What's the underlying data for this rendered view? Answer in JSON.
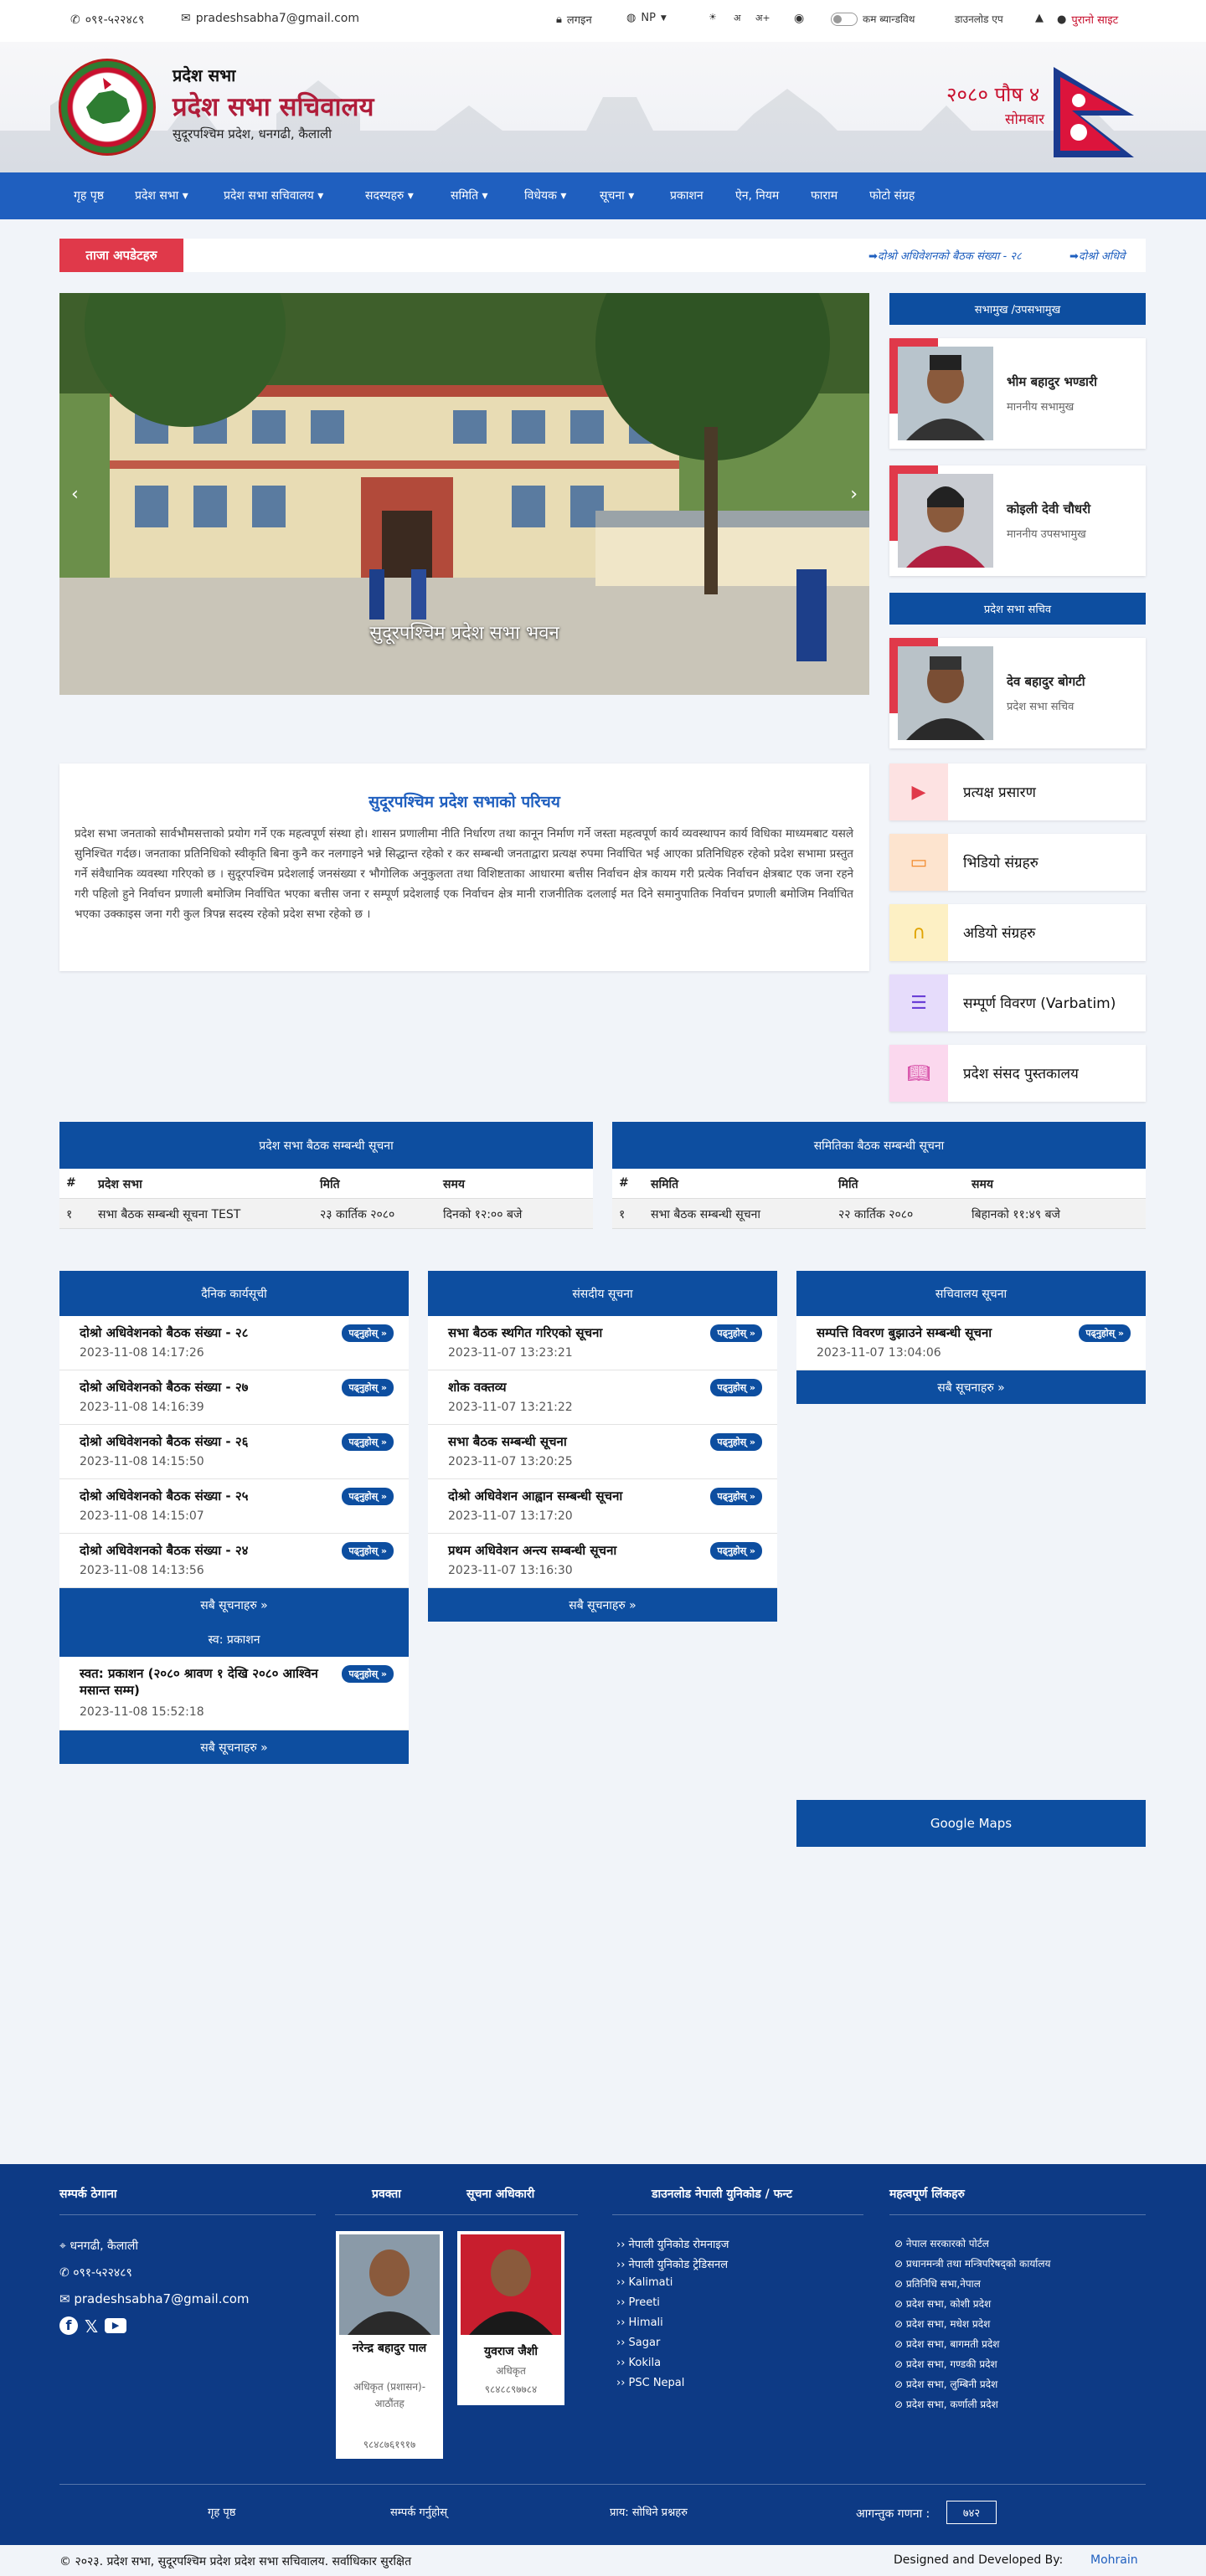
{
  "topbar": {
    "phone": "०९१-५२२४८९",
    "email": "pradeshsabha7@gmail.com",
    "login": "लगइन",
    "lang": "NP",
    "font_minus": "अ-",
    "font_normal": "अ",
    "font_plus": "अ+",
    "contrast": "कम ब्यान्डविथ",
    "download_app": "डाउनलोड एप",
    "old_site": "पुरानो साइट"
  },
  "header": {
    "brand_small": "प्रदेश सभा",
    "brand_title": "प्रदेश सभा सचिवालय",
    "brand_sub": "सुदूरपश्चिम प्रदेश, धनगढी, कैलाली",
    "date": "२०८० पौष ४",
    "day": "सोमबार"
  },
  "nav": [
    "गृह पृष्ठ",
    "प्रदेश सभा ▾",
    "प्रदेश सभा सचिवालय ▾",
    "सदस्यहरु ▾",
    "समिति ▾",
    "विधेयक ▾",
    "सूचना ▾",
    "प्रकाशन",
    "ऐन, नियम",
    "फाराम",
    "फोटो संग्रह"
  ],
  "ticker": {
    "label": "ताजा अपडेटहरु",
    "item1": "➡दोश्रो अधिवेशनको बैठक संख्या - २८",
    "item2": "➡दोश्रो अधिवे"
  },
  "slider": {
    "caption": "सुदूरपश्चिम प्रदेश सभा भवन"
  },
  "sidebar": {
    "head1": "सभामुख /उपसभामुख",
    "speaker_name": "भीम बहादुर भण्डारी",
    "speaker_role": "माननीय सभामुख",
    "deputy_name": "कोइली देवी चौधरी",
    "deputy_role": "माननीय उपसभामुख",
    "head2": "प्रदेश सभा सचिव",
    "secretary_name": "देव बहादुर बोगटी",
    "secretary_role": "प्रदेश सभा सचिव",
    "links": [
      "प्रत्यक्ष प्रसारण",
      "भिडियो संग्रहरु",
      "अडियो संग्रहरु",
      "सम्पूर्ण विवरण (Varbatim)",
      "प्रदेश संसद पुस्तकालय"
    ]
  },
  "intro": {
    "title": "सुदूरपश्चिम प्रदेश सभाको परिचय",
    "body": "प्रदेश सभा जनताको सार्वभौमसत्ताको प्रयोग गर्ने एक महत्वपूर्ण संस्था हो। शासन प्रणालीमा नीति निर्धारण तथा कानून निर्माण गर्ने जस्ता महत्वपूर्ण कार्य व्यवस्थापन कार्य विधिका माध्यमबाट यसले सुनिश्चित गर्दछ। जनताका प्रतिनिधिको स्वीकृति बिना कुनै कर नलगाइने भन्ने सिद्धान्त रहेको र कर सम्बन्धी जनताद्वारा प्रत्यक्ष रुपमा निर्वाचित भई आएका प्रतिनिधिहरु रहेको प्रदेश सभामा प्रस्तुत गर्ने संवैधानिक व्यवस्था गरिएको छ । सुदूरपश्चिम प्रदेशलाई जनसंख्या र भौगोलिक अनुकुलता तथा विशिष्टताका आधारमा बत्तीस निर्वाचन क्षेत्र कायम गरी प्रत्येक निर्वाचन क्षेत्रबाट एक जना रहने गरी पहिलो हुने निर्वाचन प्रणाली बमोजिम निर्वाचित भएका बत्तीस जना र सम्पूर्ण प्रदेशलाई एक निर्वाचन क्षेत्र मानी राजनीतिक दललाई मत दिने समानुपातिक निर्वाचन प्रणाली बमोजिम निर्वाचित भएका उक्काइस जना गरी कुल त्रिपन्न सदस्य रहेको प्रदेश सभा रहेको छ ।"
  },
  "table1": {
    "title": "प्रदेश सभा बैठक सम्बन्धी सूचना",
    "cols": [
      "#",
      "प्रदेश सभा",
      "मिति",
      "समय"
    ],
    "row": [
      "१",
      "सभा बैठक सम्बन्धी सूचना TEST",
      "२३ कार्तिक २०८०",
      "दिनको १२:०० बजे"
    ]
  },
  "table2": {
    "title": "समितिका बैठक सम्बन्धी सूचना",
    "cols": [
      "#",
      "समिति",
      "मिति",
      "समय"
    ],
    "row": [
      "१",
      "सभा बैठक सम्बन्धी सूचना",
      "२२ कार्तिक २०८०",
      "बिहानको ११:४९ बजे"
    ]
  },
  "read_label": "पढ्नुहोस्",
  "more_label": "सबै सूचनाहरु",
  "daily": {
    "title": "दैनिक कार्यसूची",
    "items": [
      {
        "t": "दोश्रो अधिवेशनको बैठक संख्या - २८",
        "d": "2023-11-08 14:17:26"
      },
      {
        "t": "दोश्रो अधिवेशनको बैठक संख्या - २७",
        "d": "2023-11-08 14:16:39"
      },
      {
        "t": "दोश्रो अधिवेशनको बैठक संख्या - २६",
        "d": "2023-11-08 14:15:50"
      },
      {
        "t": "दोश्रो अधिवेशनको बैठक संख्या - २५",
        "d": "2023-11-08 14:15:07"
      },
      {
        "t": "दोश्रो अधिवेशनको बैठक संख्या - २४",
        "d": "2023-11-08 14:13:56"
      }
    ]
  },
  "parliament": {
    "title": "संसदीय सूचना",
    "items": [
      {
        "t": "सभा बैठक स्थगित गरिएको सूचना",
        "d": "2023-11-07 13:23:21"
      },
      {
        "t": "शोक वक्तव्य",
        "d": "2023-11-07 13:21:22"
      },
      {
        "t": "सभा बैठक सम्बन्धी सूचना",
        "d": "2023-11-07 13:20:25"
      },
      {
        "t": "दोश्रो अधिवेशन आह्वान सम्बन्धी सूचना",
        "d": "2023-11-07 13:17:20"
      },
      {
        "t": "प्रथम अधिवेशन अन्त्य सम्बन्धी सूचना",
        "d": "2023-11-07 13:16:30"
      }
    ]
  },
  "secretariat": {
    "title": "सचिवालय सूचना",
    "items": [
      {
        "t": "सम्पत्ति विवरण बुझाउने सम्बन्धी सूचना",
        "d": "2023-11-07 13:04:06"
      }
    ]
  },
  "publication": {
    "title": "स्व: प्रकाशन",
    "items": [
      {
        "t": "स्वत: प्रकाशन (२०८० श्रावण १ देखि २०८० आश्विन मसान्त सम्म)",
        "d": "2023-11-08 15:52:18"
      }
    ]
  },
  "maps_label": "Google Maps",
  "footer": {
    "contact_head": "सम्पर्क ठेगाना",
    "address": "धनगढी, कैलाली",
    "phone": "०९१-५२२४८९",
    "email": "pradeshsabha7@gmail.com",
    "spokes_head": "प्रवक्ता",
    "info_head": "सूचना अधिकारी",
    "spokes_name": "नरेन्द्र बहादुर पाल",
    "spokes_role": "अधिकृत (प्रशासन)-आठौंतह",
    "spokes_phone": "९८४८७६१९१७",
    "info_name": "युवराज जैशी",
    "info_role": "अधिकृत",
    "info_phone": "९८४८८९७७८४",
    "font_head": "डाउनलोड नेपाली युनिकोड / फन्ट",
    "fonts": [
      "नेपाली युनिकोड रोमनाइज",
      "नेपाली युनिकोड ट्रेडिसनल",
      "Kalimati",
      "Preeti",
      "Himali",
      "Sagar",
      "Kokila",
      "PSC Nepal"
    ],
    "links_head": "महत्वपूर्ण लिंकहरु",
    "links": [
      "नेपाल सरकारको पोर्टल",
      "प्रधानमन्त्री तथा मन्त्रिपरिषद्को कार्यालय",
      "प्रतिनिधि सभा,नेपाल",
      "प्रदेश सभा, कोशी प्रदेश",
      "प्रदेश सभा, मधेश प्रदेश",
      "प्रदेश सभा, बागमती प्रदेश",
      "प्रदेश सभा, गण्डकी प्रदेश",
      "प्रदेश सभा, लुम्बिनी प्रदेश",
      "प्रदेश सभा, कर्णाली प्रदेश"
    ],
    "bottom_links": [
      "गृह पृष्ठ",
      "सम्पर्क गर्नुहोस्",
      "प्राय: सोधिने प्रश्नहरु"
    ],
    "visitors_label": "आगन्तुक गणना :",
    "visitors": "७४२"
  },
  "copyright": {
    "text": "© २०२३. प्रदेश सभा, सुदूरपश्चिम प्रदेश प्रदेश सभा सचिवालय. सर्वाधिकार सुरक्षित",
    "dev_label": "Designed and Developed By:",
    "dev": "Mohrain"
  }
}
